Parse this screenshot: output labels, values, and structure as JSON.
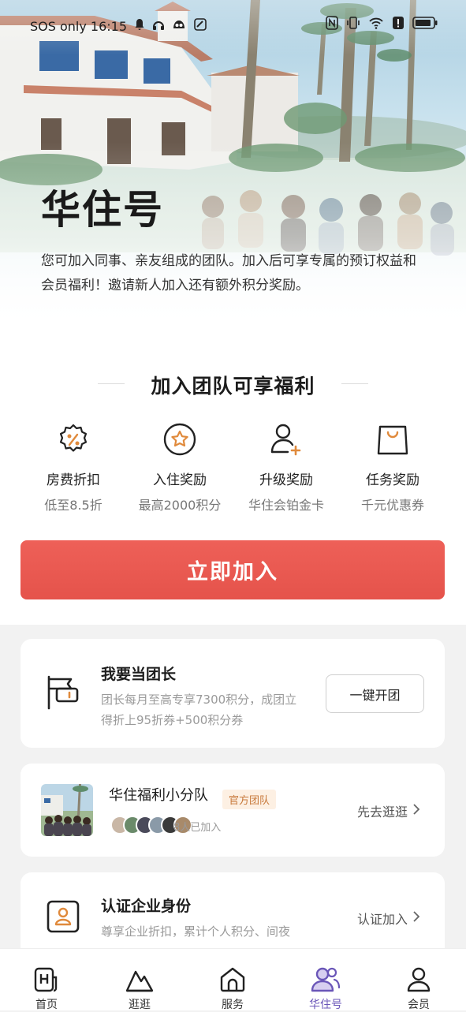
{
  "status_bar": {
    "left_text": "SOS only 16:15"
  },
  "hero": {
    "title": "华住号",
    "description": "您可加入同事、亲友组成的团队。加入后可享专属的预订权益和会员福利！邀请新人加入还有额外积分奖励。"
  },
  "benefits": {
    "heading": "加入团队可享福利",
    "items": [
      {
        "icon": "discount-percent-icon",
        "title": "房费折扣",
        "subtitle": "低至8.5折"
      },
      {
        "icon": "star-badge-icon",
        "title": "入住奖励",
        "subtitle": "最高2000积分"
      },
      {
        "icon": "user-upgrade-icon",
        "title": "升级奖励",
        "subtitle": "华住会铂金卡"
      },
      {
        "icon": "shopping-bag-icon",
        "title": "任务奖励",
        "subtitle": "千元优惠券"
      }
    ]
  },
  "join_button": "立即加入",
  "leader_card": {
    "icon": "flag-icon",
    "title": "我要当团长",
    "description": "团长每月至高专享7300积分，成团立得折上95折券+500积分券",
    "button": "一键开团"
  },
  "team_card": {
    "title": "华住福利小分队",
    "badge": "官方团队",
    "member_count": "8人已加入",
    "link": "先去逛逛"
  },
  "enterprise_card": {
    "icon": "enterprise-id-icon",
    "title": "认证企业身份",
    "description": "尊享企业折扣，累计个人积分、间夜",
    "link": "认证加入"
  },
  "tabbar": {
    "items": [
      {
        "label": "首页",
        "icon": "home-hotel-icon"
      },
      {
        "label": "逛逛",
        "icon": "explore-icon"
      },
      {
        "label": "服务",
        "icon": "service-house-icon"
      },
      {
        "label": "华住号",
        "icon": "team-users-icon",
        "active": true
      },
      {
        "label": "会员",
        "icon": "member-user-icon"
      }
    ]
  },
  "colors": {
    "primary_red": "#e5534b",
    "badge_orange": "#c7783a",
    "active_tab": "#6a56b8"
  }
}
